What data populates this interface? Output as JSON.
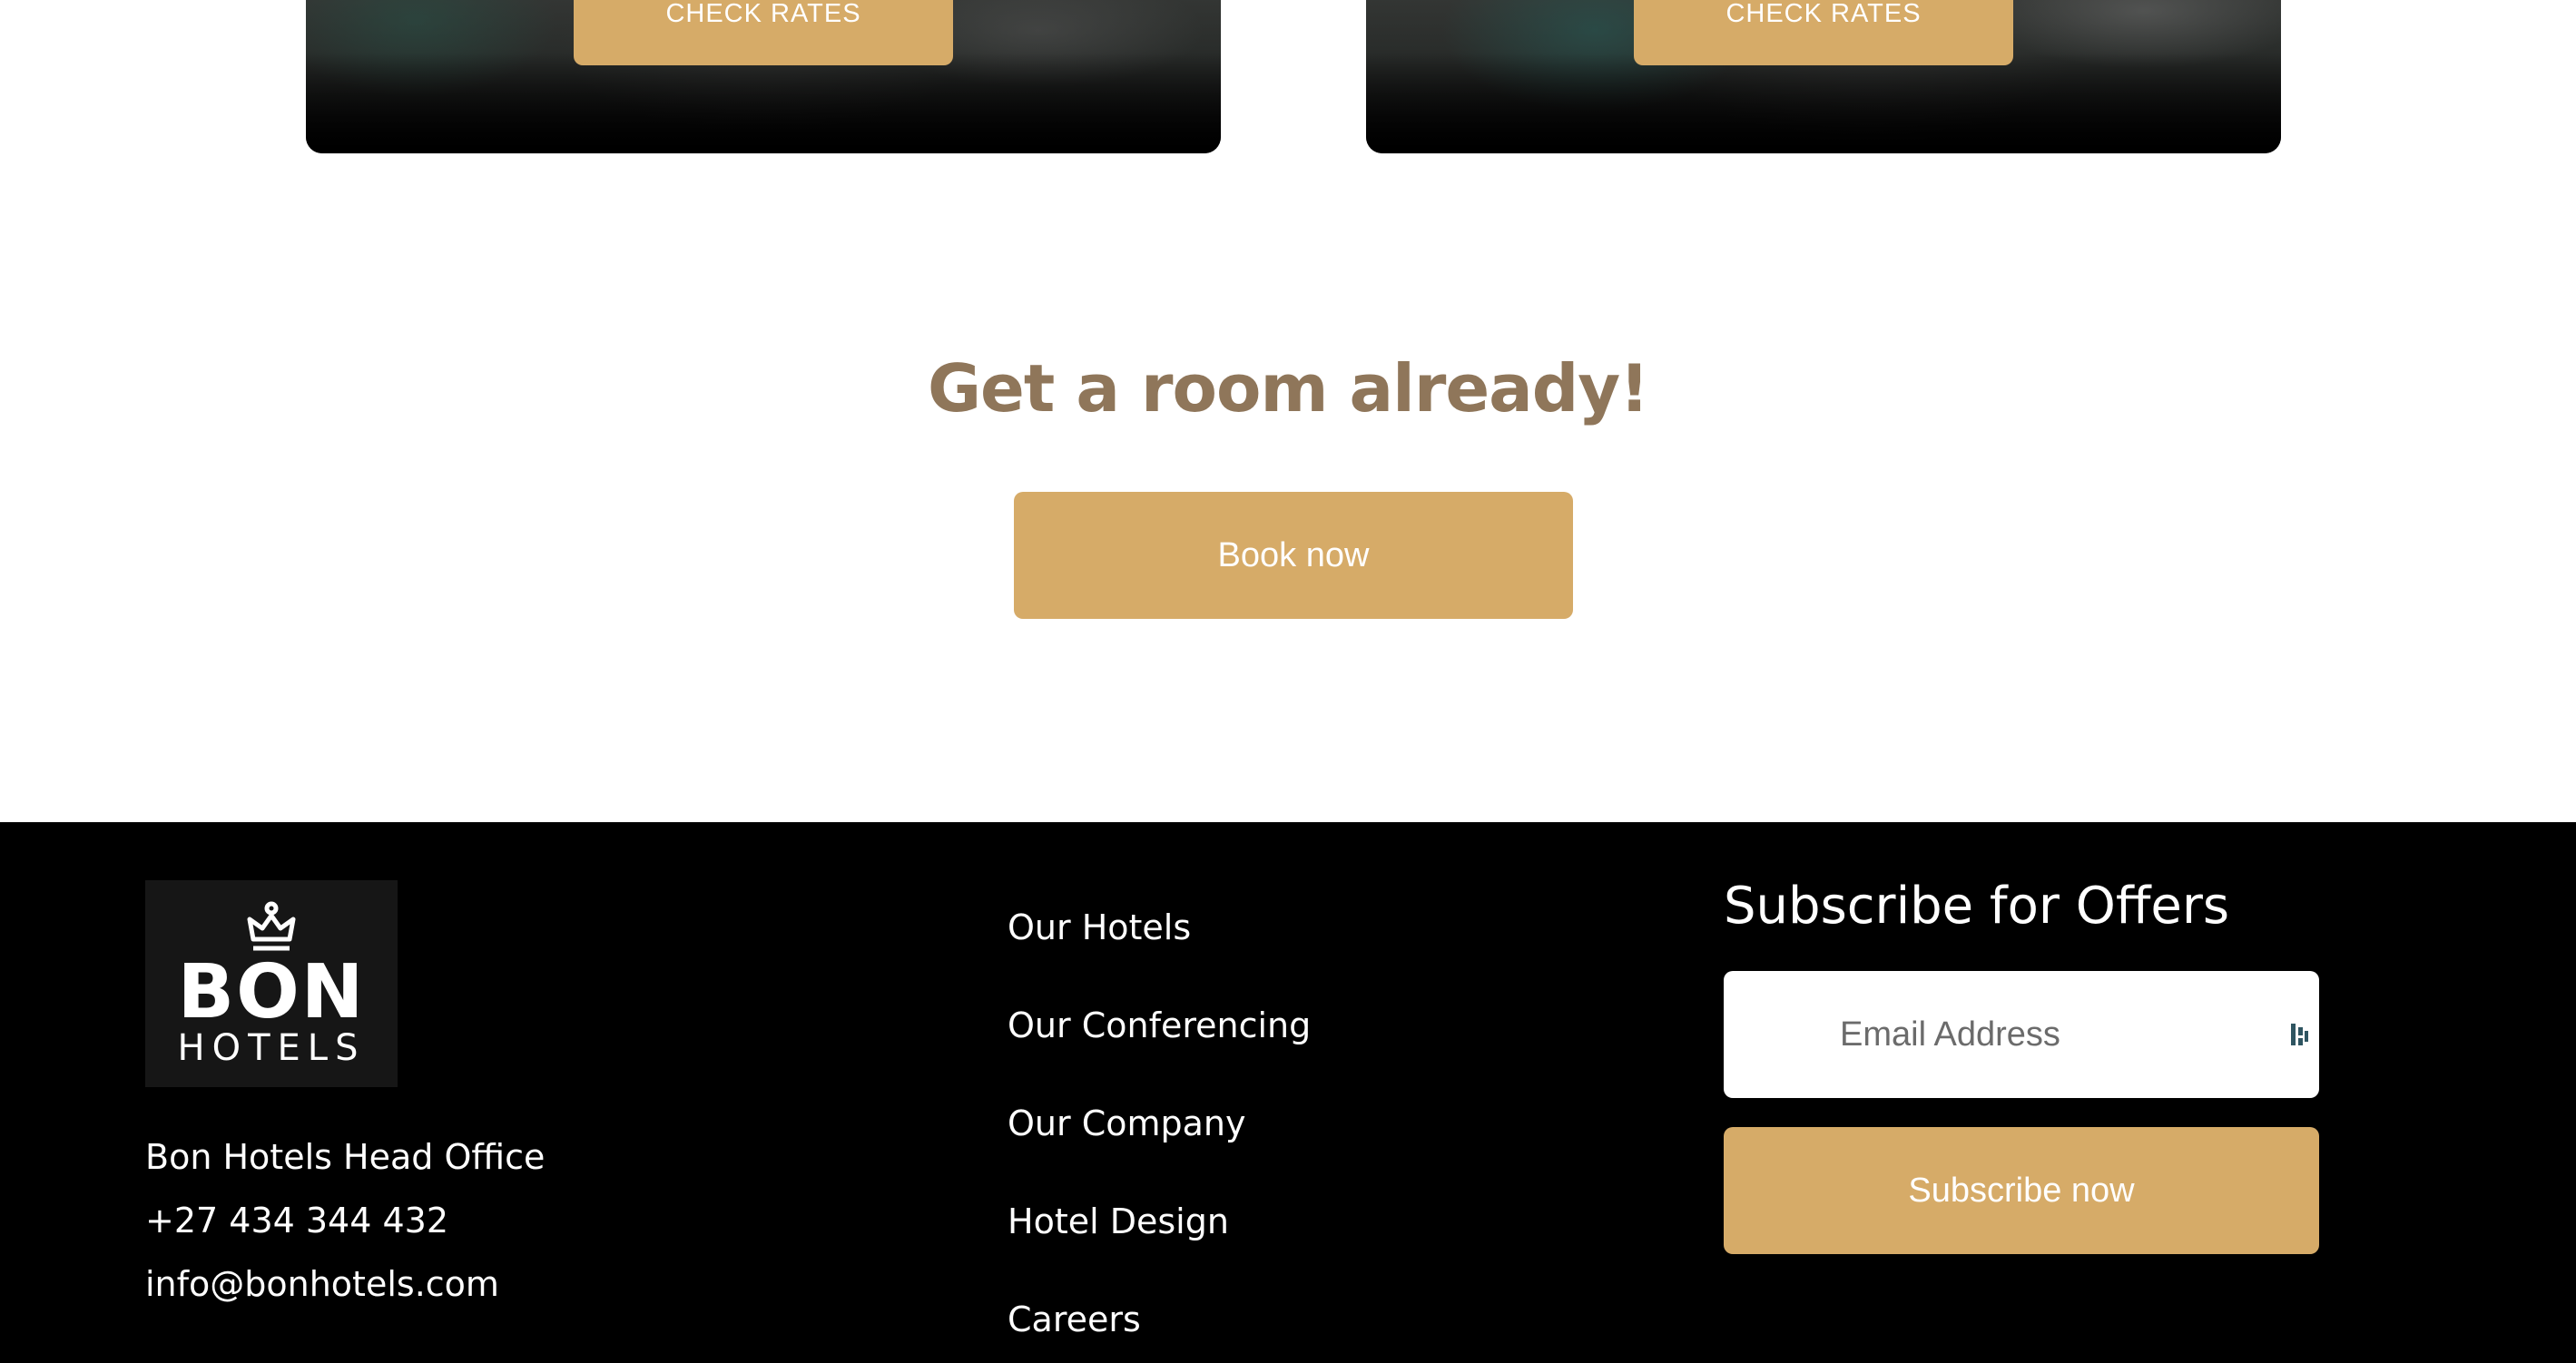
{
  "rooms": {
    "cards": [
      {
        "cta_label": "CHECK RATES"
      },
      {
        "cta_label": "CHECK RATES"
      }
    ]
  },
  "cta": {
    "heading": "Get a room already!",
    "book_label": "Book now"
  },
  "footer": {
    "logo": {
      "word": "BON",
      "sub": "HOTELS",
      "icon": "crown-icon"
    },
    "contact": {
      "office": "Bon Hotels Head Office",
      "phone": "+27 434 344 432",
      "email": "info@bonhotels.com"
    },
    "nav": [
      "Our Hotels",
      "Our Conferencing",
      "Our Company",
      "Hotel Design",
      "Careers"
    ],
    "subscribe": {
      "title": "Subscribe for Offers",
      "email_placeholder": "Email Address",
      "email_value": "",
      "button_label": "Subscribe now",
      "field_icon": "password-manager-icon"
    }
  },
  "colors": {
    "accent": "#d6ab68",
    "heading": "#8f765a",
    "footer_bg": "#000000"
  }
}
